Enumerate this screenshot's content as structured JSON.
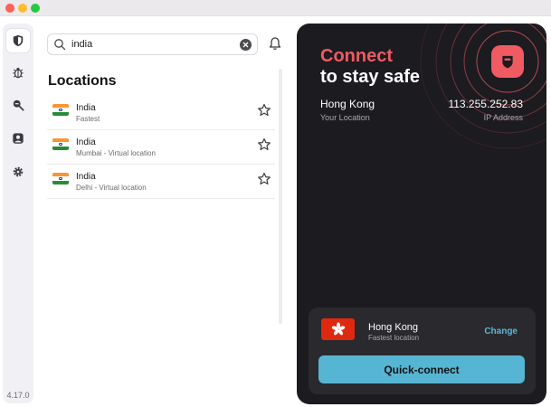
{
  "app": {
    "version": "4.17.0"
  },
  "sidebar": {
    "items": [
      {
        "icon": "shield-icon",
        "active": true
      },
      {
        "icon": "bug-icon",
        "active": false
      },
      {
        "icon": "search-alert-icon",
        "active": false
      },
      {
        "icon": "account-icon",
        "active": false
      },
      {
        "icon": "gear-icon",
        "active": false
      }
    ]
  },
  "search": {
    "value": "india",
    "icon": "search-icon",
    "clear_icon": "clear-icon"
  },
  "notifications": {
    "icon": "bell-icon"
  },
  "locations": {
    "heading": "Locations",
    "items": [
      {
        "country": "India",
        "detail": "Fastest",
        "flag": "india-flag-icon",
        "favorite": false
      },
      {
        "country": "India",
        "detail": "Mumbai - Virtual location",
        "flag": "india-flag-icon",
        "favorite": false
      },
      {
        "country": "India",
        "detail": "Delhi - Virtual location",
        "flag": "india-flag-icon",
        "favorite": false
      }
    ]
  },
  "status": {
    "line1": "Connect",
    "line2": "to stay safe",
    "location": "Hong Kong",
    "location_label": "Your Location",
    "ip": "113.255.252.83",
    "ip_label": "IP Address"
  },
  "quick": {
    "country": "Hong Kong",
    "detail": "Fastest location",
    "change_label": "Change",
    "button_label": "Quick-connect",
    "flag": "hong-kong-flag-icon"
  },
  "colors": {
    "accent_red": "#ef5a63",
    "accent_blue": "#56b5d2",
    "panel_dark": "#1c1b1f"
  }
}
